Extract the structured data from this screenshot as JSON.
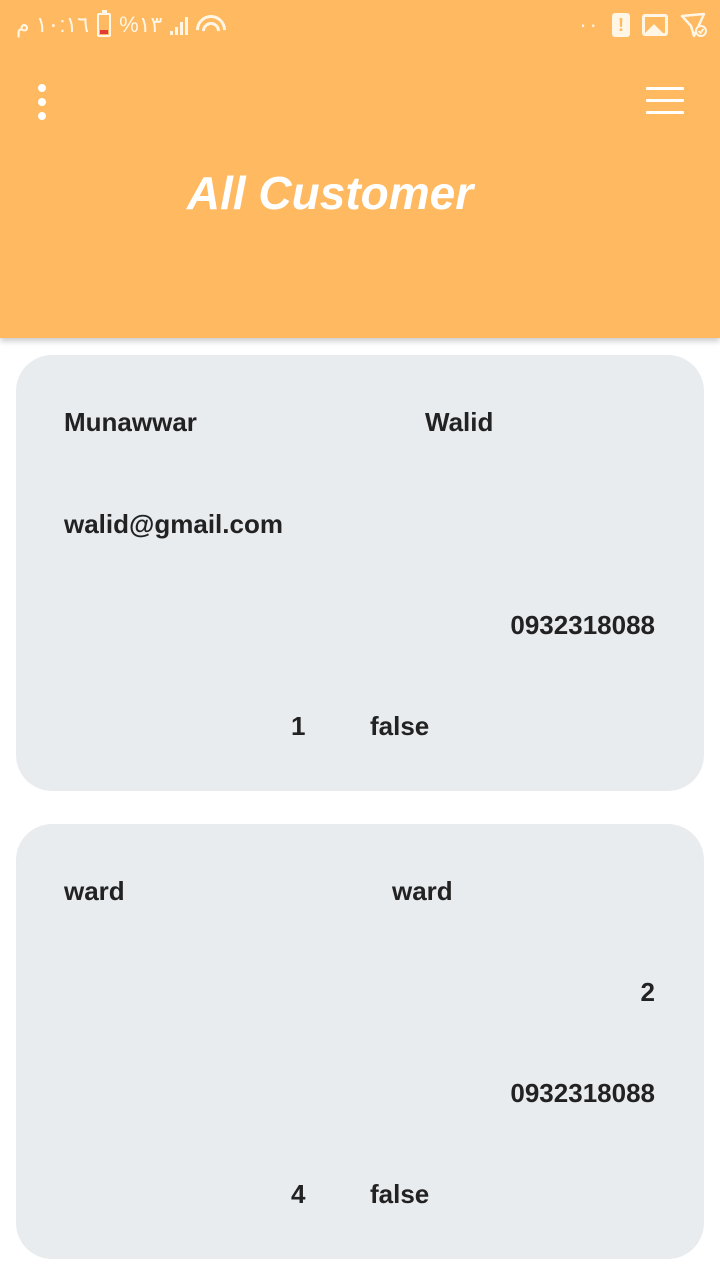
{
  "status_bar": {
    "time": "١٠:١٦ م",
    "battery_percent": "%١٣",
    "right_dots": "··"
  },
  "header": {
    "title": "All Customer",
    "background_color": "#ffb960"
  },
  "icons": {
    "left": "more-vertical-icon",
    "right": "menu-icon"
  },
  "customers": [
    {
      "first_name": "Munawwar",
      "last_name": "Walid",
      "email": "walid@gmail.com",
      "phone": "0932318088",
      "id": "1",
      "flag": "false"
    },
    {
      "first_name": "ward",
      "last_name": "ward",
      "extra": "2",
      "phone": "0932318088",
      "id": "4",
      "flag": "false"
    }
  ]
}
